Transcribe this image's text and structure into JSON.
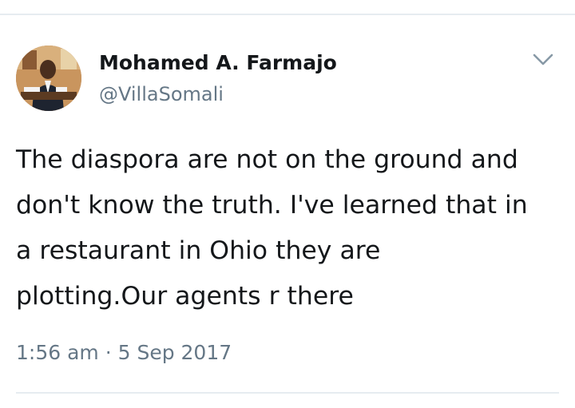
{
  "author": {
    "display_name": "Mohamed A. Farmajo",
    "handle": "@VillaSomali",
    "avatar_icon": "profile-photo"
  },
  "tweet": {
    "lines": [
      "The diaspora are not on the ground and",
      "don't know the truth. I've learned that in",
      "a restaurant in Ohio they are",
      "plotting.Our agents r there"
    ],
    "timestamp": "1:56 am · 5 Sep 2017"
  },
  "icons": {
    "menu": "chevron-down-icon"
  },
  "colors": {
    "text_primary": "#14171a",
    "text_secondary": "#657786",
    "divider": "#e6ecf0"
  }
}
